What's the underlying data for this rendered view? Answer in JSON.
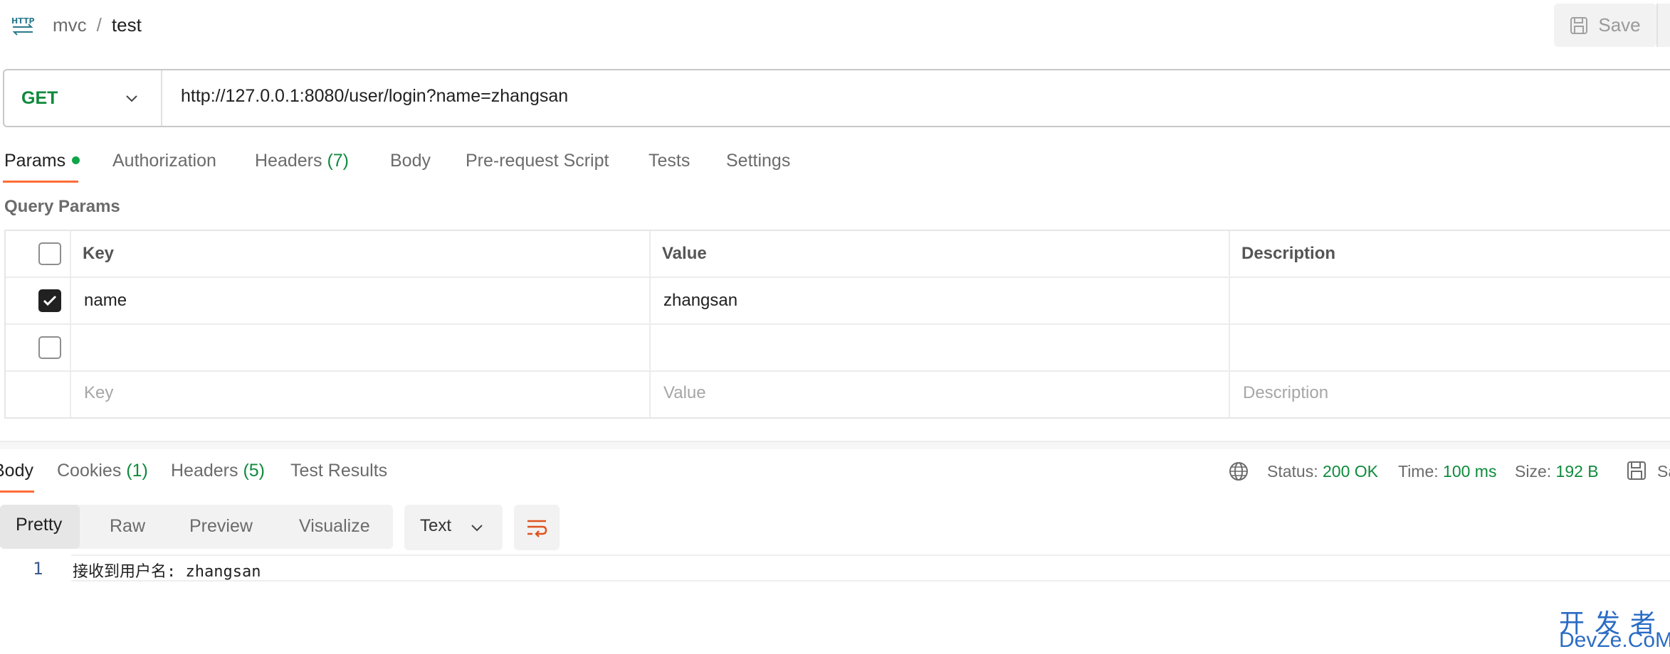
{
  "breadcrumb": {
    "collection": "mvc",
    "separator": "/",
    "request": "test"
  },
  "toolbar": {
    "save_label": "Save"
  },
  "request": {
    "method": "GET",
    "url": "http://127.0.0.1:8080/user/login?name=zhangsan"
  },
  "request_tabs": {
    "params": "Params",
    "authorization": "Authorization",
    "headers": "Headers",
    "headers_count": "(7)",
    "body": "Body",
    "prerequest": "Pre-request Script",
    "tests": "Tests",
    "settings": "Settings"
  },
  "query_params": {
    "title": "Query Params",
    "columns": {
      "key": "Key",
      "value": "Value",
      "description": "Description"
    },
    "rows": [
      {
        "checked": true,
        "key": "name",
        "value": "zhangsan",
        "description": ""
      },
      {
        "checked": false,
        "key": "",
        "value": "",
        "description": ""
      }
    ],
    "placeholders": {
      "key": "Key",
      "value": "Value",
      "description": "Description"
    }
  },
  "response_tabs": {
    "body": "Body",
    "cookies": "Cookies",
    "cookies_count": "(1)",
    "headers": "Headers",
    "headers_count": "(5)",
    "test_results": "Test Results"
  },
  "response_status": {
    "status_label": "Status:",
    "status_value": "200 OK",
    "time_label": "Time:",
    "time_value": "100 ms",
    "size_label": "Size:",
    "size_value": "192 B",
    "save_label": "Sa"
  },
  "view_modes": {
    "pretty": "Pretty",
    "raw": "Raw",
    "preview": "Preview",
    "visualize": "Visualize"
  },
  "format": {
    "selected": "Text"
  },
  "response_body": {
    "line_number": "1",
    "content": "接收到用户名: zhangsan"
  },
  "watermark": {
    "title": "开发者",
    "site": "DevZe.CoM"
  },
  "colors": {
    "accent": "#ff6c37",
    "success": "#0f8a3c",
    "watermark": "#2b6cc4"
  }
}
